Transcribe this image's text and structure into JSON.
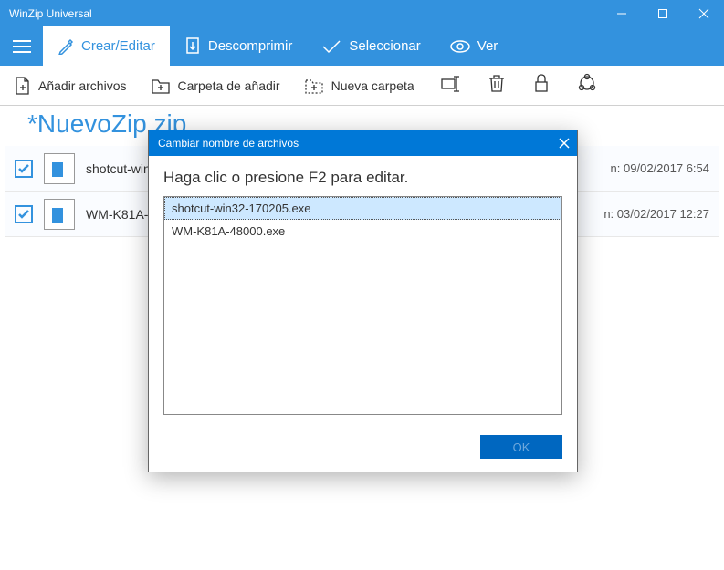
{
  "window": {
    "title": "WinZip Universal"
  },
  "tabs": {
    "create": "Crear/Editar",
    "decompress": "Descomprimir",
    "select": "Seleccionar",
    "view": "Ver"
  },
  "toolbar": {
    "add_files": "Añadir archivos",
    "add_folder": "Carpeta de añadir",
    "new_folder": "Nueva carpeta"
  },
  "archive": {
    "name": "*NuevoZip.zip"
  },
  "files": [
    {
      "name": "shotcut-win32-170205.exe",
      "date": "09/02/2017 6:54"
    },
    {
      "name": "WM-K81A-48000.exe",
      "date": "03/02/2017 12:27"
    }
  ],
  "dialog": {
    "title": "Cambiar nombre de archivos",
    "message": "Haga clic o presione F2 para editar.",
    "items": [
      "shotcut-win32-170205.exe",
      "WM-K81A-48000.exe"
    ],
    "ok": "OK"
  },
  "date_prefix": "n: "
}
